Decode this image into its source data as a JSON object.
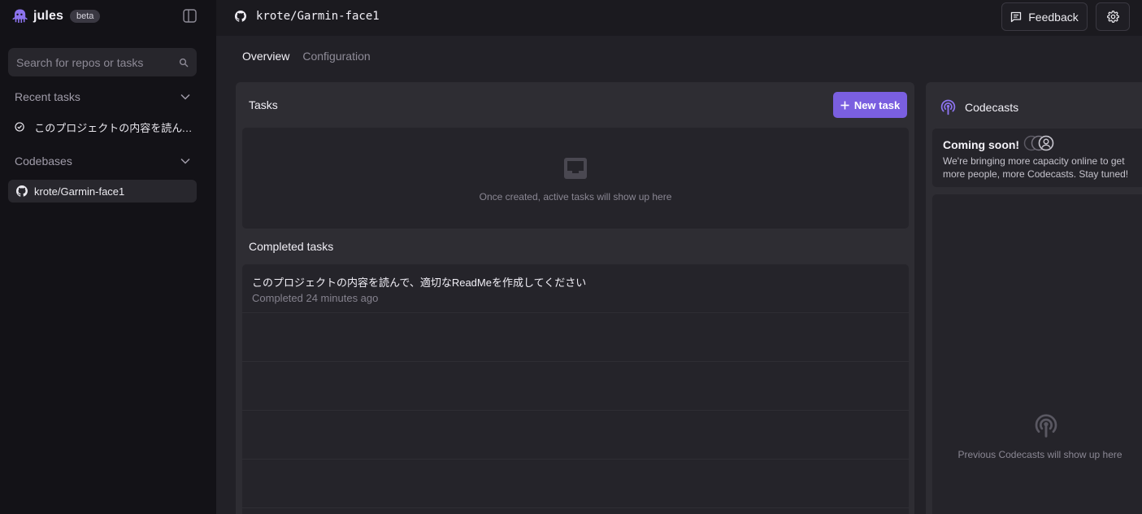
{
  "app": {
    "name": "jules",
    "badge": "beta"
  },
  "sidebar": {
    "search_placeholder": "Search for repos or tasks",
    "recent_tasks_label": "Recent tasks",
    "recent_tasks": [
      {
        "label": "このプロジェクトの内容を読んで、適..."
      }
    ],
    "codebases_label": "Codebases",
    "codebases": [
      {
        "label": "krote/Garmin-face1"
      }
    ]
  },
  "header": {
    "repo": "krote/Garmin-face1",
    "feedback_label": "Feedback"
  },
  "tabs": [
    {
      "label": "Overview",
      "active": true
    },
    {
      "label": "Configuration",
      "active": false
    }
  ],
  "tasks": {
    "title": "Tasks",
    "new_task_label": "New task",
    "empty_message": "Once created, active tasks will show up here",
    "completed_title": "Completed tasks",
    "completed": [
      {
        "title": "このプロジェクトの内容を読んで、適切なReadMeを作成してください",
        "status": "Completed 24 minutes ago"
      }
    ]
  },
  "codecasts": {
    "title": "Codecasts",
    "coming_title": "Coming soon!",
    "coming_desc": "We're bringing more capacity online to get more people, more Codecasts. Stay tuned!",
    "empty_message": "Previous Codecasts will show up here"
  },
  "colors": {
    "accent": "#7a5fe0",
    "sidebar_bg": "#131217",
    "main_bg": "#222127"
  }
}
